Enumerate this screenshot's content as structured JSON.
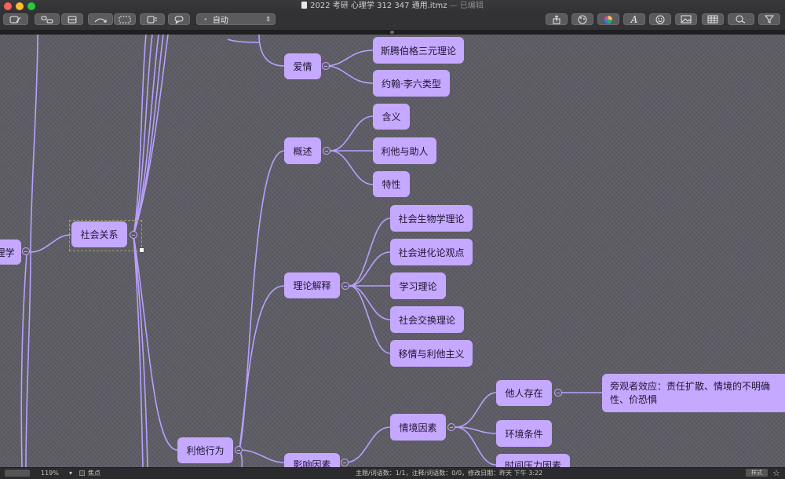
{
  "window": {
    "title": "2022 考研 心理学  312 347 通用.itmz",
    "edited_label": "— 已编辑"
  },
  "toolbar": {
    "layout_mode": "自动",
    "left_icons": [
      "new-topic-icon",
      "subtopic-icon",
      "sibling-icon",
      "relationship-icon",
      "boundary-icon",
      "note-icon",
      "callout-icon"
    ],
    "right_icons": [
      "share-icon",
      "theme-icon",
      "color-icon",
      "font-icon",
      "emoji-icon",
      "image-icon",
      "table-icon",
      "search-icon",
      "filter-icon"
    ]
  },
  "mindmap": {
    "root_partial": "理学",
    "social": "社会关系",
    "love": "爱情",
    "love_children": [
      "斯腾伯格三元理论",
      "约翰·李六类型"
    ],
    "overview": "概述",
    "overview_children": [
      "含义",
      "利他与助人",
      "特性"
    ],
    "theory": "理论解释",
    "theory_children": [
      "社会生物学理论",
      "社会进化论观点",
      "学习理论",
      "社会交换理论",
      "移情与利他主义"
    ],
    "altruism": "利他行为",
    "influence_partial": "影响因素",
    "situational": "情境因素",
    "situational_children": [
      "他人存在",
      "环境条件",
      "时间压力因素"
    ],
    "bystander": "旁观者效应：责任扩散、情境的不明确性、价恐惧"
  },
  "statusbar": {
    "zoom": "119%",
    "focus_label": "焦点",
    "stats": "主题/词语数：1/1，注释/词语数：0/0，修改日期：昨天 下午 3:22",
    "style_button": "样式"
  },
  "colors": {
    "node": "#c5a8ff",
    "line": "#b9a0ff",
    "canvas": "#5d5c64"
  }
}
